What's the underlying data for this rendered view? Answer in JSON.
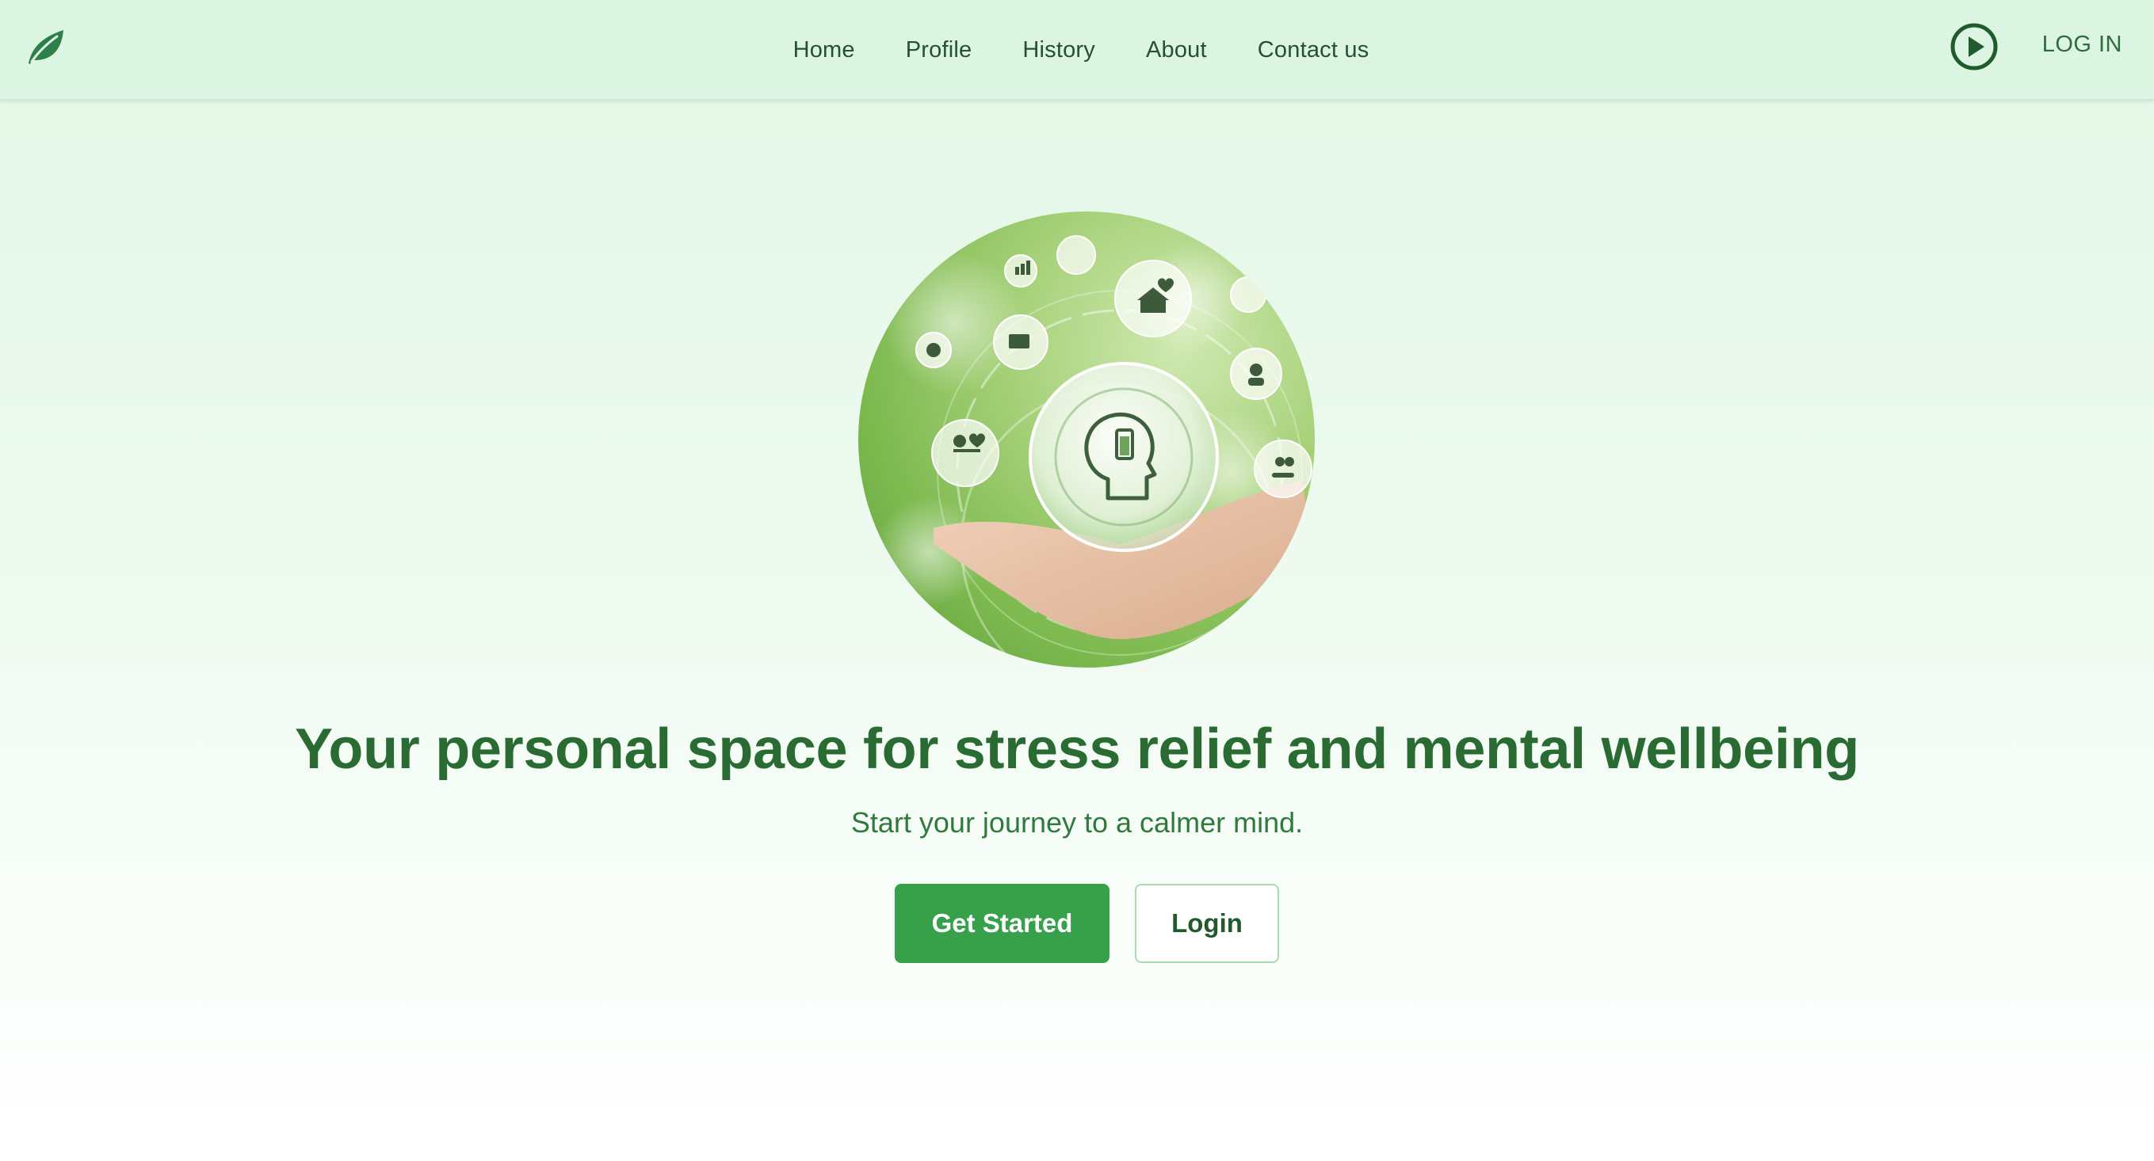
{
  "nav": {
    "logo_icon": "leaf-icon",
    "links": [
      {
        "label": "Home"
      },
      {
        "label": "Profile"
      },
      {
        "label": "History"
      },
      {
        "label": "About"
      },
      {
        "label": "Contact us"
      }
    ],
    "play_icon": "play-circle-icon",
    "login_label": "LOG IN"
  },
  "hero": {
    "image": "hand-holding-mental-health-bubble",
    "title": "Your personal space for stress relief and mental wellbeing",
    "subtitle": "Start your journey to a calmer mind.",
    "primary_button": "Get Started",
    "secondary_button": "Login"
  },
  "colors": {
    "brand_green": "#36a04b",
    "heading_green": "#2a6b34",
    "nav_bg": "#dbf5e2"
  }
}
